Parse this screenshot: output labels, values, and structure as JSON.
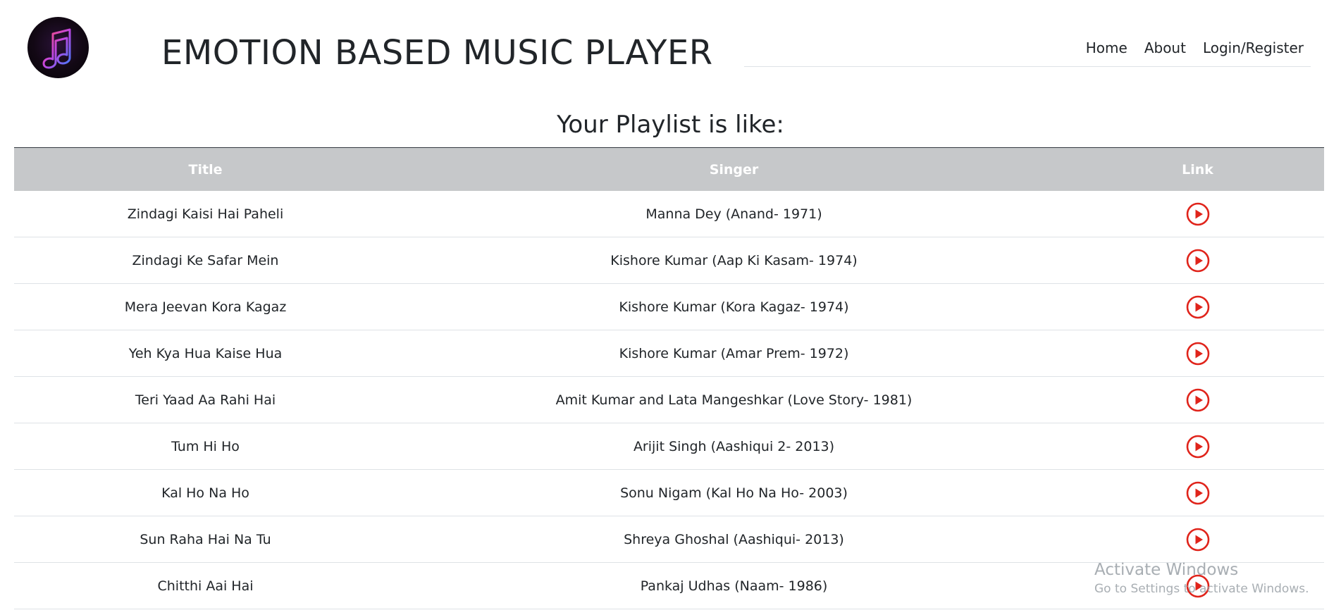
{
  "header": {
    "title": "EMOTION BASED MUSIC PLAYER",
    "nav": [
      {
        "label": "Home"
      },
      {
        "label": "About"
      },
      {
        "label": "Login/Register"
      }
    ]
  },
  "main": {
    "heading": "Your Playlist is like:",
    "table": {
      "columns": [
        "Title",
        "Singer",
        "Link"
      ],
      "rows": [
        {
          "title": "Zindagi Kaisi Hai Paheli",
          "singer": "Manna Dey (Anand- 1971)",
          "link_icon": "play-circle-icon"
        },
        {
          "title": "Zindagi Ke Safar Mein",
          "singer": "Kishore Kumar (Aap Ki Kasam- 1974)",
          "link_icon": "play-circle-icon"
        },
        {
          "title": "Mera Jeevan Kora Kagaz",
          "singer": "Kishore Kumar (Kora Kagaz- 1974)",
          "link_icon": "play-circle-icon"
        },
        {
          "title": "Yeh Kya Hua Kaise Hua",
          "singer": "Kishore Kumar (Amar Prem- 1972)",
          "link_icon": "play-circle-icon"
        },
        {
          "title": "Teri Yaad Aa Rahi Hai",
          "singer": "Amit Kumar and Lata Mangeshkar (Love Story- 1981)",
          "link_icon": "play-circle-icon"
        },
        {
          "title": "Tum Hi Ho",
          "singer": "Arijit Singh (Aashiqui 2- 2013)",
          "link_icon": "play-circle-icon"
        },
        {
          "title": "Kal Ho Na Ho",
          "singer": "Sonu Nigam (Kal Ho Na Ho- 2003)",
          "link_icon": "play-circle-icon"
        },
        {
          "title": "Sun Raha Hai Na Tu",
          "singer": "Shreya Ghoshal (Aashiqui- 2013)",
          "link_icon": "play-circle-icon"
        },
        {
          "title": "Chitthi Aai Hai",
          "singer": "Pankaj Udhas (Naam- 1986)",
          "link_icon": "play-circle-icon"
        }
      ]
    }
  },
  "watermark": {
    "title": "Activate Windows",
    "subtitle": "Go to Settings to activate Windows."
  },
  "colors": {
    "play_icon": "#e0241b",
    "table_header_bg": "#c6c8ca",
    "text": "#212529"
  }
}
